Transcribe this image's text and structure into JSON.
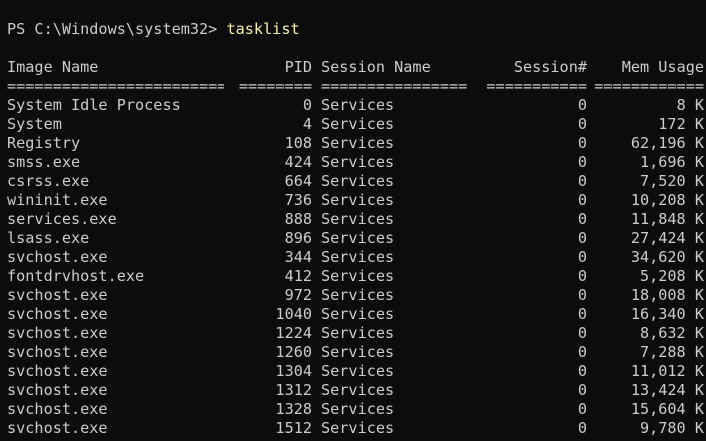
{
  "prompt": "PS C:\\Windows\\system32> ",
  "command": "tasklist",
  "headers": {
    "image_name": "Image Name",
    "pid": "PID",
    "session_name": "Session Name",
    "session_num": "Session#",
    "mem_usage": "Mem Usage"
  },
  "separators": {
    "image_name": "=========================",
    "pid": "========",
    "session_name": "================",
    "session_num": "===========",
    "mem_usage": "============"
  },
  "rows": [
    {
      "name": "System Idle Process",
      "pid": "0",
      "session": "Services",
      "num": "0",
      "mem": "8 K"
    },
    {
      "name": "System",
      "pid": "4",
      "session": "Services",
      "num": "0",
      "mem": "172 K"
    },
    {
      "name": "Registry",
      "pid": "108",
      "session": "Services",
      "num": "0",
      "mem": "62,196 K"
    },
    {
      "name": "smss.exe",
      "pid": "424",
      "session": "Services",
      "num": "0",
      "mem": "1,696 K"
    },
    {
      "name": "csrss.exe",
      "pid": "664",
      "session": "Services",
      "num": "0",
      "mem": "7,520 K"
    },
    {
      "name": "wininit.exe",
      "pid": "736",
      "session": "Services",
      "num": "0",
      "mem": "10,208 K"
    },
    {
      "name": "services.exe",
      "pid": "888",
      "session": "Services",
      "num": "0",
      "mem": "11,848 K"
    },
    {
      "name": "lsass.exe",
      "pid": "896",
      "session": "Services",
      "num": "0",
      "mem": "27,424 K"
    },
    {
      "name": "svchost.exe",
      "pid": "344",
      "session": "Services",
      "num": "0",
      "mem": "34,620 K"
    },
    {
      "name": "fontdrvhost.exe",
      "pid": "412",
      "session": "Services",
      "num": "0",
      "mem": "5,208 K"
    },
    {
      "name": "svchost.exe",
      "pid": "972",
      "session": "Services",
      "num": "0",
      "mem": "18,008 K"
    },
    {
      "name": "svchost.exe",
      "pid": "1040",
      "session": "Services",
      "num": "0",
      "mem": "16,340 K"
    },
    {
      "name": "svchost.exe",
      "pid": "1224",
      "session": "Services",
      "num": "0",
      "mem": "8,632 K"
    },
    {
      "name": "svchost.exe",
      "pid": "1260",
      "session": "Services",
      "num": "0",
      "mem": "7,288 K"
    },
    {
      "name": "svchost.exe",
      "pid": "1304",
      "session": "Services",
      "num": "0",
      "mem": "11,012 K"
    },
    {
      "name": "svchost.exe",
      "pid": "1312",
      "session": "Services",
      "num": "0",
      "mem": "13,424 K"
    },
    {
      "name": "svchost.exe",
      "pid": "1328",
      "session": "Services",
      "num": "0",
      "mem": "15,604 K"
    },
    {
      "name": "svchost.exe",
      "pid": "1512",
      "session": "Services",
      "num": "0",
      "mem": "9,780 K"
    }
  ],
  "colors": {
    "background": "#0c0c0c",
    "foreground": "#cccccc",
    "command": "#f9f1a5"
  }
}
